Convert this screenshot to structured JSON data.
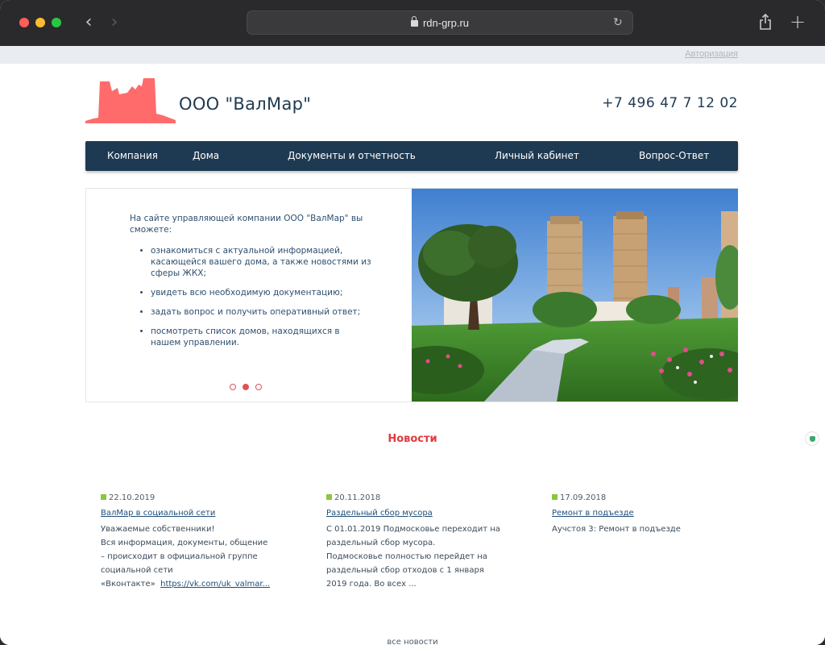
{
  "browser": {
    "url": "rdn-grp.ru"
  },
  "header": {
    "auth_link": "Авторизация",
    "company_name": "ООО \"ВалМар\"",
    "phone": "+7 496 47 7 12 02"
  },
  "nav": {
    "items": [
      {
        "label": "Компания"
      },
      {
        "label": "Дома"
      },
      {
        "label": "Документы и отчетность"
      },
      {
        "label": "Личный кабинет"
      },
      {
        "label": "Вопрос-Ответ"
      }
    ]
  },
  "hero": {
    "intro": "На сайте управляющей компании ООО \"ВалМар\" вы сможете:",
    "bullets": [
      "ознакомиться с актуальной информацией, касающейся вашего дома, а также новостями из сферы ЖКХ;",
      "увидеть всю необходимую документацию;",
      "задать вопрос и получить оперативный ответ;",
      "посмотреть список домов, находящихся в нашем управлении."
    ],
    "slides_total": 3,
    "active_slide": 2
  },
  "news": {
    "title": "Новости",
    "items": [
      {
        "date": "22.10.2019",
        "link": "ВалМар в социальной сети",
        "body_lines": [
          "Уважаемые собственники!",
          "Вся информация, документы, общение",
          "– происходит  в официальной группе",
          "социальной сети"
        ],
        "body_last_prefix": "«Вконтакте»  ",
        "body_link": "https://vk.com/uk_valmar..."
      },
      {
        "date": "20.11.2018",
        "link": "Раздельный сбор мусора",
        "body_lines": [
          "С 01.01.2019 Подмосковье переходит на",
          "раздельный сбор мусора.",
          "Подмосковье полностью перейдет на",
          "раздельный сбор отходов с 1 января",
          "2019 года. Во всех ..."
        ]
      },
      {
        "date": "17.09.2018",
        "link": "Ремонт в подъезде",
        "body_lines": [
          "Аучстоя 3: Ремонт в подъезде"
        ]
      }
    ],
    "all_news": "все новости"
  },
  "colors": {
    "brand_navy": "#1e3a52",
    "accent_red": "#e0393e",
    "logo_red": "#ff6b6b",
    "date_marker": "#8cc63f"
  }
}
